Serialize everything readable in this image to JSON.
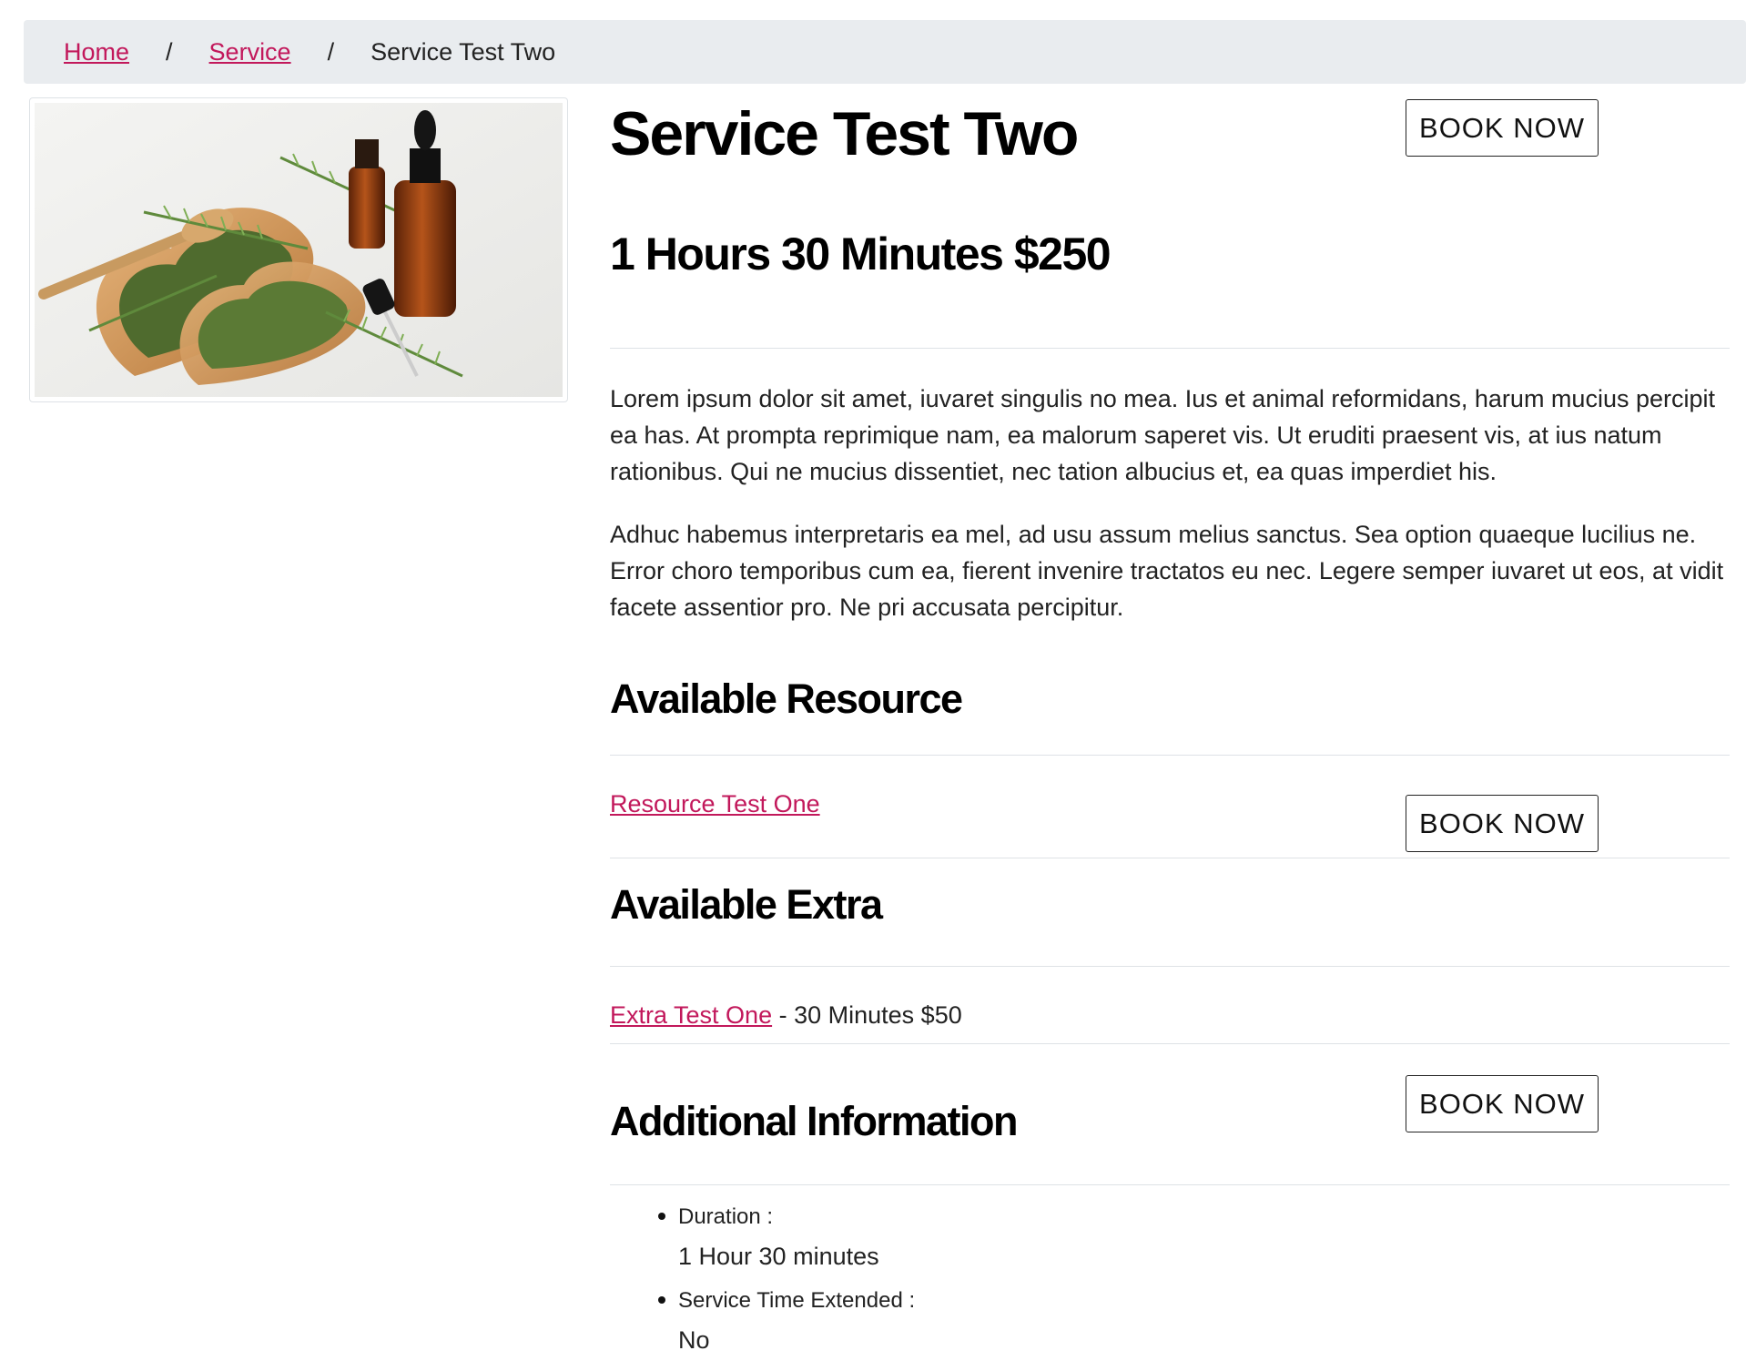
{
  "breadcrumb": {
    "home": "Home",
    "separator": "/",
    "service": "Service",
    "current": "Service Test Two"
  },
  "service": {
    "title": "Service Test Two",
    "book_label": "BOOK NOW",
    "price_line": "1 Hours 30 Minutes $250",
    "description": [
      "Lorem ipsum dolor sit amet, iuvaret singulis no mea. Ius et animal reformidans, harum mucius percipit ea has. At prompta reprimique nam, ea malorum saperet vis. Ut eruditi praesent vis, at ius natum rationibus. Qui ne mucius dissentiet, nec tation albucius et, ea quas imperdiet his.",
      "Adhuc habemus interpretaris ea mel, ad usu assum melius sanctus. Sea option quaeque lucilius ne. Error choro temporibus cum ea, fierent invenire tractatos eu nec. Legere semper iuvaret ut eos, at vidit facete assentior pro. Ne pri accusata percipitur."
    ]
  },
  "resources": {
    "heading": "Available Resource",
    "items": [
      {
        "label": "Resource Test One",
        "book_label": "BOOK NOW"
      }
    ]
  },
  "extras": {
    "heading": "Available Extra",
    "items": [
      {
        "label": "Extra Test One",
        "detail": "- 30 Minutes $50"
      }
    ]
  },
  "additional": {
    "heading": "Additional Information",
    "book_label": "BOOK NOW",
    "items": [
      {
        "label": "Duration :",
        "value": "1 Hour 30 minutes"
      },
      {
        "label": "Service Time Extended :",
        "value": "No"
      }
    ]
  },
  "colors": {
    "link": "#c2185b",
    "breadcrumb_bg": "#e9ecef"
  }
}
